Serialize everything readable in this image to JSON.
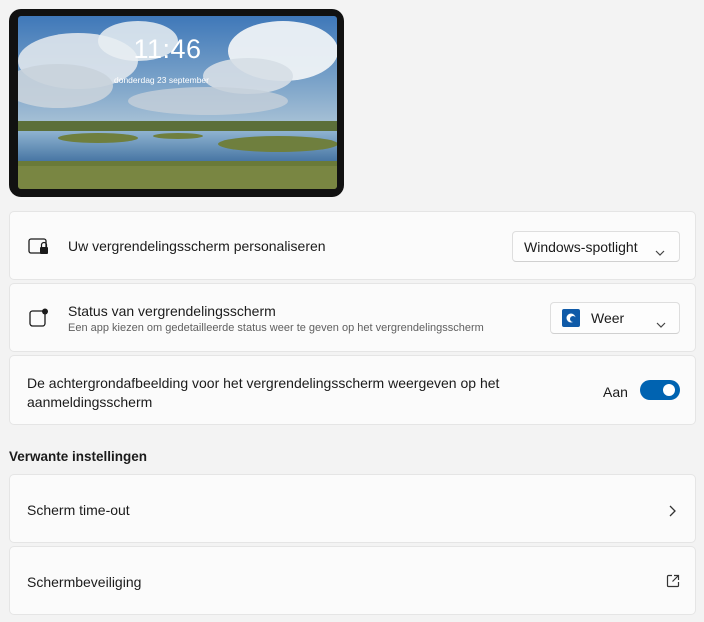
{
  "preview": {
    "time": "11:46",
    "date": "donderdag 23 september"
  },
  "lockscreen": {
    "label": "Uw vergrendelingsscherm personaliseren",
    "selected": "Windows-spotlight"
  },
  "status": {
    "label": "Status van vergrendelingsscherm",
    "description": "Een app kiezen om gedetailleerde status weer te geven op het vergrendelingsscherm",
    "selected": "Weer"
  },
  "background_signin": {
    "label_line1": "De achtergrondafbeelding voor het vergrendelingsscherm weergeven op het",
    "label_line2": "aanmeldingsscherm",
    "state": "Aan",
    "on": true
  },
  "related": {
    "title": "Verwante instellingen",
    "items": [
      {
        "label": "Scherm time-out",
        "icon": "chevron-right-icon"
      },
      {
        "label": "Schermbeveiliging",
        "icon": "external-link-icon"
      }
    ]
  },
  "colors": {
    "accent": "#0063b1",
    "page_bg": "#f3f3f3",
    "card_bg": "#fbfbfb"
  }
}
